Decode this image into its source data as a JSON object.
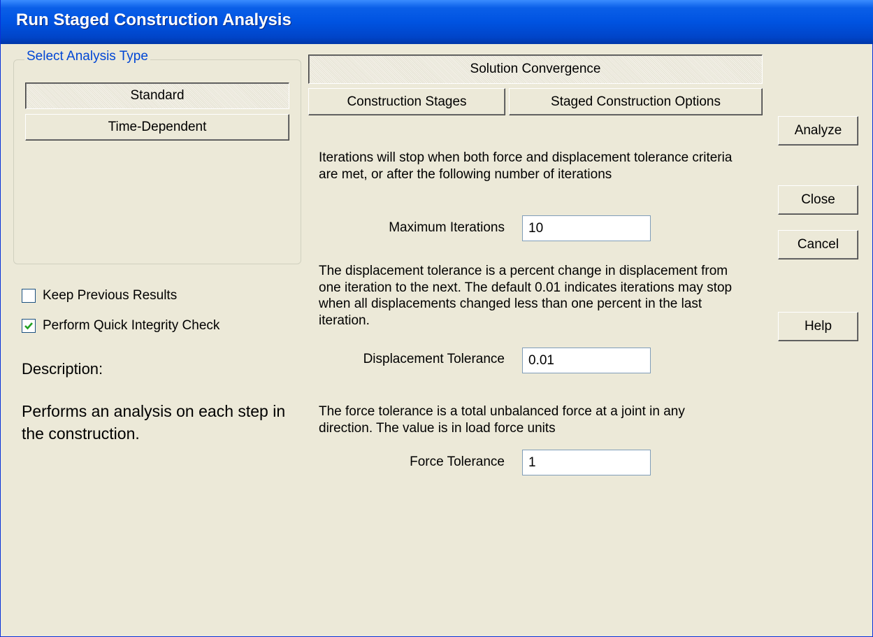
{
  "window": {
    "title": "Run Staged Construction Analysis"
  },
  "analysis_type": {
    "group_label": "Select Analysis Type",
    "options": [
      {
        "label": "Standard",
        "selected": true
      },
      {
        "label": "Time-Dependent",
        "selected": false
      }
    ]
  },
  "checkboxes": {
    "keep_previous": {
      "label": "Keep Previous Results",
      "checked": false
    },
    "quick_integrity": {
      "label": "Perform Quick Integrity Check",
      "checked": true
    }
  },
  "description": {
    "label": "Description:",
    "text": "Performs an analysis on each step in the construction."
  },
  "tabs": {
    "solution_convergence": "Solution Convergence",
    "construction_stages": "Construction Stages",
    "staged_options": "Staged Construction Options",
    "active": "Solution Convergence"
  },
  "convergence": {
    "iterations_text": "Iterations will stop when both force and displacement tolerance criteria are met, or after the following number of iterations",
    "max_iterations_label": "Maximum Iterations",
    "max_iterations_value": "10",
    "displacement_text": "The displacement tolerance is a percent change in displacement from one iteration to the next.  The default 0.01 indicates iterations may stop when all displacements changed less than one percent in the last iteration.",
    "displacement_label": "Displacement Tolerance",
    "displacement_value": "0.01",
    "force_text": "The force tolerance is a total unbalanced force at a joint in any direction.  The value is in load force units",
    "force_label": "Force Tolerance",
    "force_value": "1"
  },
  "buttons": {
    "analyze": "Analyze",
    "close": "Close",
    "cancel": "Cancel",
    "help": "Help"
  }
}
